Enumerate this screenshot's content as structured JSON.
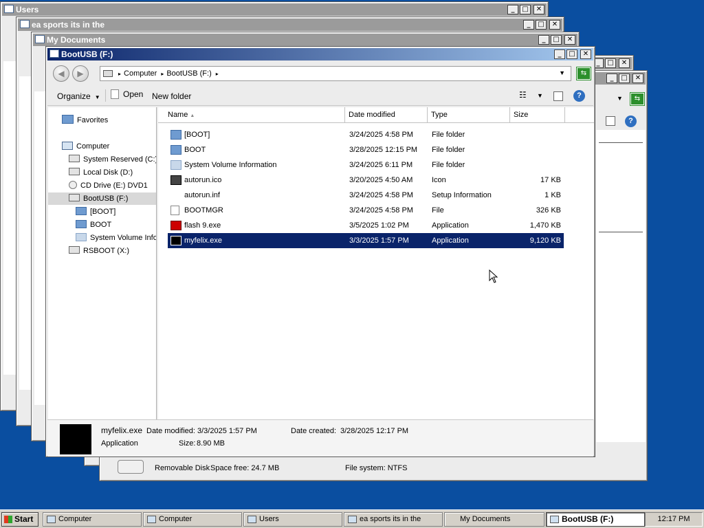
{
  "windows_back": [
    {
      "title": "Users"
    },
    {
      "title": "ea sports its in the"
    },
    {
      "title": "My Documents"
    }
  ],
  "window_right": {
    "status_drive_type": "Removable Disk",
    "status_space": "Space free: 24.7 MB",
    "status_fs": "File system: NTFS"
  },
  "main": {
    "title": "BootUSB (F:)",
    "address": {
      "crumbs": [
        "Computer",
        "BootUSB (F:)"
      ]
    },
    "toolbar": {
      "organize": "Organize",
      "open": "Open",
      "new_folder": "New folder"
    },
    "tree": {
      "favorites": "Favorites",
      "computer": "Computer",
      "drives": [
        "System Reserved (C:)",
        "Local Disk (D:)",
        "CD Drive (E:) DVD1",
        "BootUSB (F:)"
      ],
      "subfolders": [
        "[BOOT]",
        "BOOT",
        "System Volume Information"
      ],
      "rsboot": "RSBOOT (X:)"
    },
    "columns": {
      "name": "Name",
      "date": "Date modified",
      "type": "Type",
      "size": "Size"
    },
    "files": [
      {
        "name": "[BOOT]",
        "date": "3/24/2025 4:58 PM",
        "type": "File folder",
        "size": "",
        "icon": "folder-icon"
      },
      {
        "name": "BOOT",
        "date": "3/28/2025 12:15 PM",
        "type": "File folder",
        "size": "",
        "icon": "folder-icon"
      },
      {
        "name": "System Volume Information",
        "date": "3/24/2025 6:11 PM",
        "type": "File folder",
        "size": "",
        "icon": "folder-icon"
      },
      {
        "name": "autorun.ico",
        "date": "3/20/2025 4:50 AM",
        "type": "Icon",
        "size": "17 KB",
        "icon": "image-icon"
      },
      {
        "name": "autorun.inf",
        "date": "3/24/2025 4:58 PM",
        "type": "Setup Information",
        "size": "1 KB",
        "icon": "settings-file-icon"
      },
      {
        "name": "BOOTMGR",
        "date": "3/24/2025 4:58 PM",
        "type": "File",
        "size": "326 KB",
        "icon": "file-icon"
      },
      {
        "name": "flash 9.exe",
        "date": "3/5/2025 1:02 PM",
        "type": "Application",
        "size": "1,470 KB",
        "icon": "flash-app-icon"
      },
      {
        "name": "myfelix.exe",
        "date": "3/3/2025 1:57 PM",
        "type": "Application",
        "size": "9,120 KB",
        "icon": "felix-app-icon",
        "selected": true
      }
    ],
    "details": {
      "name": "myfelix.exe",
      "modified_label": "Date modified:",
      "modified": "3/3/2025 1:57 PM",
      "created_label": "Date created:",
      "created": "3/28/2025 12:17 PM",
      "type": "Application",
      "size_label": "Size:",
      "size": "8.90 MB"
    }
  },
  "taskbar": {
    "start": "Start",
    "items": [
      "Computer",
      "Computer",
      "Users",
      "ea sports its in the",
      "My Documents",
      "BootUSB (F:)"
    ],
    "clock": "12:17 PM"
  },
  "colors": {
    "desktop": "#0a4ea0",
    "selection": "#0a246a",
    "title_active": "#0a246a"
  }
}
